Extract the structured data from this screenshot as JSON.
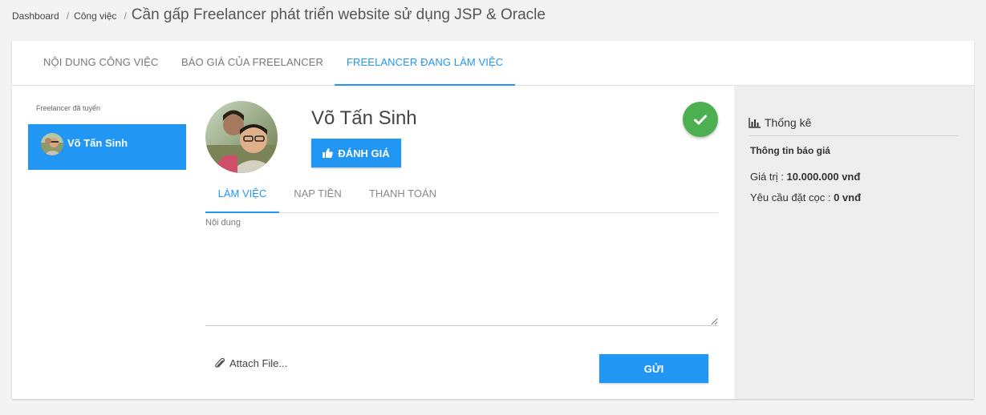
{
  "breadcrumb": {
    "items": [
      "Dashboard",
      "Công việc"
    ],
    "separator": "/",
    "title": "Cần gấp Freelancer phát triển website sử dụng JSP & Oracle"
  },
  "tabs": [
    {
      "label": "NỘI DUNG CÔNG VIỆC",
      "active": false
    },
    {
      "label": "BÁO GIÁ CỦA FREELANCER",
      "active": false
    },
    {
      "label": "FREELANCER ĐANG LÀM VIỆC",
      "active": true
    }
  ],
  "sidebar": {
    "label": "Freelancer đã tuyển",
    "items": [
      {
        "name": "Võ Tấn Sinh",
        "selected": true
      }
    ]
  },
  "profile": {
    "name": "Võ Tấn Sinh",
    "rate_button": "ĐÁNH GIÁ",
    "status": "check-icon"
  },
  "subtabs": [
    {
      "label": "LÀM VIỆC",
      "active": true
    },
    {
      "label": "NẠP TIỀN",
      "active": false
    },
    {
      "label": "THANH TOÁN",
      "active": false
    }
  ],
  "editor": {
    "placeholder": "Nội dung",
    "value": ""
  },
  "attach_label": "Attach File...",
  "send_label": "GỬI",
  "stats": {
    "title": "Thống kê",
    "subtitle": "Thông tin báo giá",
    "value_label": "Giá trị :",
    "value": "10.000.000 vnđ",
    "deposit_label": "Yêu cầu đặt cọc :",
    "deposit": "0 vnđ"
  },
  "colors": {
    "accent": "#2196f3",
    "success": "#4caf50",
    "panel": "#eeeeee"
  }
}
